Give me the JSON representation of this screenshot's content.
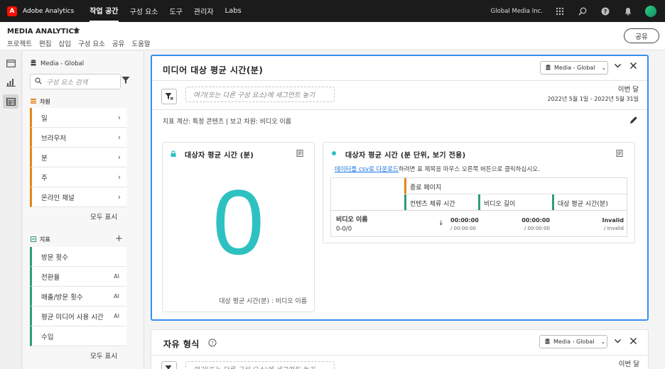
{
  "topnav": {
    "logo": "A",
    "app_name": "Adobe Analytics",
    "items": [
      "작업 공간",
      "구성 요소",
      "도구",
      "관리자",
      "Labs"
    ],
    "org_name": "Global Media Inc."
  },
  "project": {
    "title": "MEDIA ANALYTICS",
    "menu": [
      "프로젝트",
      "편집",
      "삽입",
      "구성 요소",
      "공유",
      "도움말"
    ],
    "share_button": "공유"
  },
  "left_panel": {
    "report_suite": "Media - Global",
    "search_placeholder": "구성 요소 검색",
    "dimensions_header": "차원",
    "dimensions": [
      "일",
      "브라우저",
      "분",
      "주",
      "온라인 채널"
    ],
    "metrics_header": "지표",
    "metrics": [
      "방문 횟수",
      "전환율",
      "매출/방문 횟수",
      "평균 미디어 사용 시간",
      "수입"
    ],
    "show_all": "모두 표시",
    "metric_ai_flags": [
      false,
      true,
      true,
      true,
      false
    ]
  },
  "panel1": {
    "title": "미디어 대상 평균 시간(분)",
    "report_suite": "Media - Global",
    "segment_placeholder": "여기(또는 다른 구성 요소)에 세그먼트 놓기",
    "period_label": "이번 달",
    "period_dates": "2022년 5월 1일 - 2022년 5월 31일",
    "description": "지표 계산: 특정 콘텐츠 | 보고 차원: 비디오 이름",
    "summary_card": {
      "title": "대상자 평균 시간 (분)",
      "value": "0",
      "footer": "대상 평균 시간(분) : 비디오 이름"
    },
    "table_card": {
      "title": "대상자 평균 시간 (분 단위, 보기 전용)",
      "download_link": "데이터를 csv로 다운로드",
      "download_text": "하려면 표 제목을 마우스 오른쪽 버튼으로 클릭하십시오.",
      "segment_header": "종료 페이지",
      "columns": [
        "컨텐츠 체류 시간",
        "비디오 길이",
        "대상 평균 시간(분)"
      ],
      "row_header": "비디오 이름",
      "row_range": "0-0/0",
      "values": [
        "00:00:00",
        "00:00:00",
        "Invalid"
      ],
      "subvalues": [
        "/ 00:00:00",
        "/ 00:00:00",
        "/ Invalid"
      ]
    }
  },
  "panel2": {
    "title": "자유 형식",
    "report_suite": "Media - Global",
    "segment_placeholder": "여기(또는 다른 구성 요소)에 세그먼트 놓기",
    "period_label": "이번 달"
  },
  "colors": {
    "accent": "#378ef0",
    "big_number": "#2ec1c1",
    "dimension": "#e68619",
    "metric": "#2d9d78"
  }
}
